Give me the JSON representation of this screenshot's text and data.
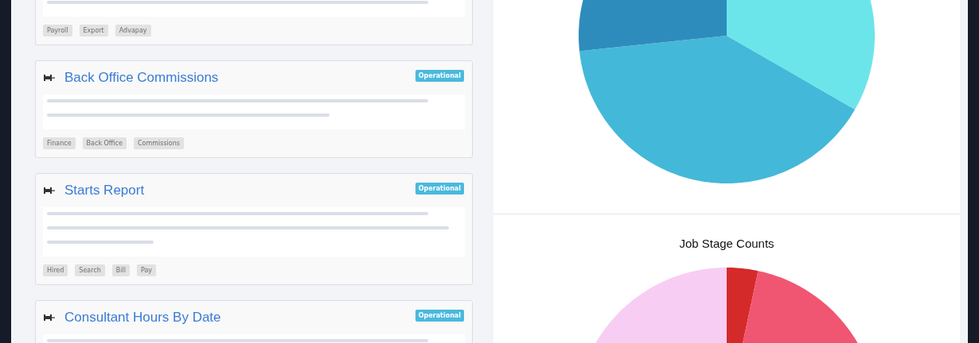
{
  "reports": [
    {
      "lines": [
        {
          "level": 0.93
        }
      ],
      "tags": [
        "Payroll",
        "Export",
        "Advapay"
      ]
    },
    {
      "title": "Back Office Commissions",
      "status": "Operational",
      "lines": [
        {
          "level": 0.93
        },
        {
          "level": 0.69
        }
      ],
      "tags": [
        "Finance",
        "Back Office",
        "Commissions"
      ]
    },
    {
      "title": "Starts Report",
      "status": "Operational",
      "lines": [
        {
          "level": 0.93
        },
        {
          "level": 0.98
        },
        {
          "level": 0.26
        }
      ],
      "tags": [
        "Hired",
        "Search",
        "Bill",
        "Pay"
      ]
    },
    {
      "title": "Consultant Hours By Date",
      "status": "Operational",
      "lines": [
        {
          "level": 0.93
        }
      ]
    }
  ],
  "lower_chart": {
    "title": "Job Stage Counts"
  }
}
